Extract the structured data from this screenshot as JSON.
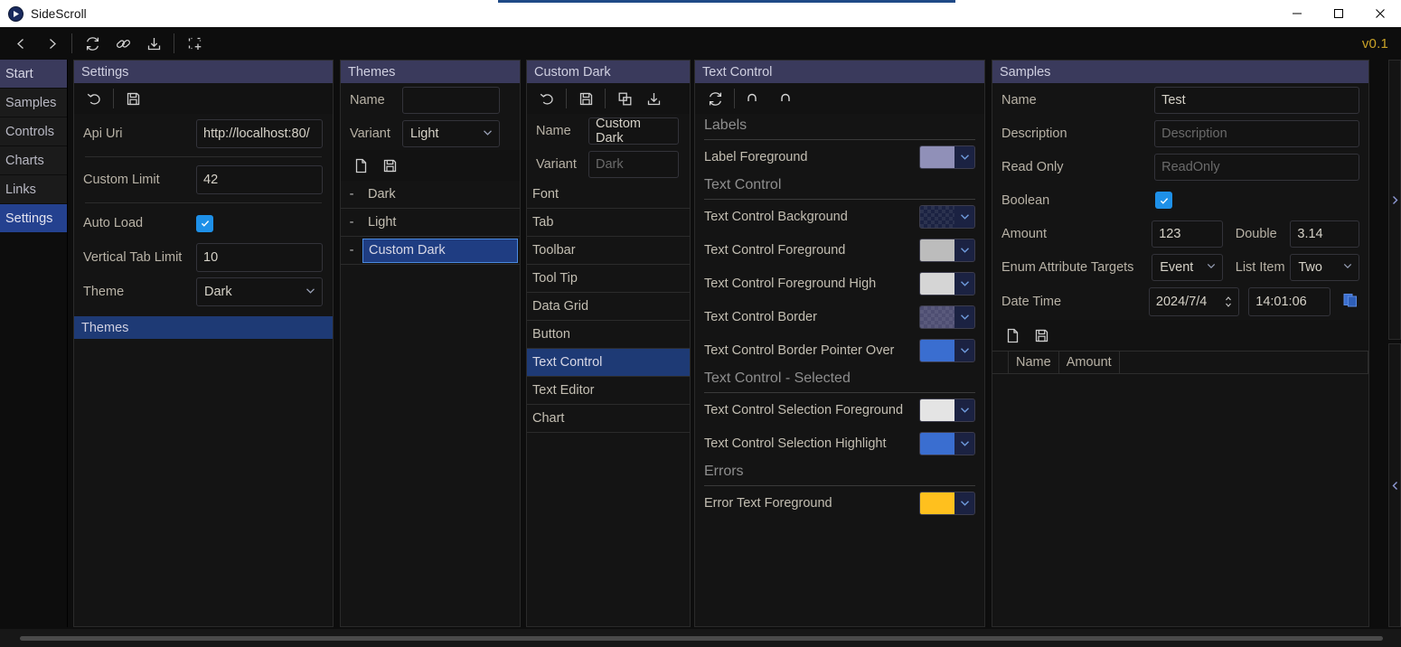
{
  "window": {
    "title": "SideScroll",
    "logo_icon": "play-circle-icon",
    "minimize": "—",
    "maximize": "☐",
    "close": "✕",
    "version": "v0.1"
  },
  "toolbar": {
    "back_icon": "chevron-left-icon",
    "forward_icon": "chevron-right-icon",
    "refresh_icon": "refresh-icon",
    "link_icon": "link-icon",
    "import_icon": "import-icon",
    "snapshot_icon": "snapshot-icon"
  },
  "sidebar": {
    "items": [
      {
        "label": "Start",
        "state": "header"
      },
      {
        "label": "Samples",
        "state": "normal"
      },
      {
        "label": "Controls",
        "state": "normal"
      },
      {
        "label": "Charts",
        "state": "normal"
      },
      {
        "label": "Links",
        "state": "normal"
      },
      {
        "label": "Settings",
        "state": "selected"
      }
    ]
  },
  "settings_panel": {
    "title": "Settings",
    "undo_icon": "undo-icon",
    "save_icon": "save-icon",
    "fields": [
      {
        "label": "Api Uri",
        "value": "http://localhost:80/"
      },
      {
        "label": "Custom Limit",
        "value": "42"
      },
      {
        "label": "Auto Load",
        "value": "checked"
      },
      {
        "label": "Vertical Tab Limit",
        "value": "10"
      },
      {
        "label": "Theme",
        "value": "Dark"
      }
    ],
    "api_uri_label": "Api Uri",
    "api_uri_value": "http://localhost:80/",
    "custom_limit_label": "Custom Limit",
    "custom_limit_value": "42",
    "auto_load_label": "Auto Load",
    "vertical_tab_limit_label": "Vertical Tab Limit",
    "vertical_tab_limit_value": "10",
    "theme_label": "Theme",
    "theme_value": "Dark",
    "themes_section_title": "Themes"
  },
  "themes_panel": {
    "title": "Themes",
    "name_label": "Name",
    "name_value": "",
    "variant_label": "Variant",
    "variant_value": "Light",
    "new_icon": "new-file-icon",
    "save_icon": "save-icon",
    "rows": [
      {
        "expander": "-",
        "name": "Dark",
        "selected": false
      },
      {
        "expander": "-",
        "name": "Light",
        "selected": false
      },
      {
        "expander": "-",
        "name": "Custom Dark",
        "selected": true
      }
    ]
  },
  "custom_dark_panel": {
    "title": "Custom Dark",
    "undo_icon": "undo-icon",
    "save_icon": "save-icon",
    "copy_icon": "copy-icon",
    "import_icon": "import-icon",
    "name_label": "Name",
    "name_value": "Custom Dark",
    "variant_label": "Variant",
    "variant_value": "Dark",
    "items": [
      {
        "label": "Font",
        "selected": false
      },
      {
        "label": "Tab",
        "selected": false
      },
      {
        "label": "Toolbar",
        "selected": false
      },
      {
        "label": "Tool Tip",
        "selected": false
      },
      {
        "label": "Data Grid",
        "selected": false
      },
      {
        "label": "Button",
        "selected": false
      },
      {
        "label": "Text Control",
        "selected": true
      },
      {
        "label": "Text Editor",
        "selected": false
      },
      {
        "label": "Chart",
        "selected": false
      }
    ]
  },
  "text_control_panel": {
    "title": "Text Control",
    "refresh_icon": "refresh-icon",
    "undo_icon": "undo-icon",
    "redo_icon": "redo-icon",
    "sections": [
      {
        "title": "Labels",
        "colors": [
          {
            "label": "Label Foreground",
            "hex": "#9090b8",
            "transparent": false
          }
        ]
      },
      {
        "title": "Text Control",
        "colors": [
          {
            "label": "Text Control Background",
            "hex": "#1b2242",
            "transparent": true
          },
          {
            "label": "Text Control Foreground",
            "hex": "#bcbcbc",
            "transparent": false
          },
          {
            "label": "Text Control Foreground High",
            "hex": "#d5d5d5",
            "transparent": false
          },
          {
            "label": "Text Control Border",
            "hex": "#4e4e72",
            "transparent": true
          },
          {
            "label": "Text Control Border Pointer Over",
            "hex": "#3a6ed0",
            "transparent": false
          }
        ]
      },
      {
        "title": "Text Control - Selected",
        "colors": [
          {
            "label": "Text Control Selection Foreground",
            "hex": "#e4e4e4",
            "transparent": false
          },
          {
            "label": "Text Control Selection Highlight",
            "hex": "#3a6ed0",
            "transparent": false
          }
        ]
      },
      {
        "title": "Errors",
        "colors": [
          {
            "label": "Error Text Foreground",
            "hex": "#ffc01e",
            "transparent": false
          }
        ]
      }
    ]
  },
  "samples_panel": {
    "title": "Samples",
    "name_label": "Name",
    "name_value": "Test",
    "description_label": "Description",
    "description_placeholder": "Description",
    "read_only_label": "Read Only",
    "read_only_placeholder": "ReadOnly",
    "boolean_label": "Boolean",
    "boolean_checked": true,
    "amount_label": "Amount",
    "amount_value": "123",
    "double_label": "Double",
    "double_value": "3.14",
    "enum_label": "Enum Attribute Targets",
    "enum_value": "Event",
    "list_item_label": "List Item",
    "list_item_value": "Two",
    "date_time_label": "Date Time",
    "date_value": "2024/7/4",
    "time_value": "14:01:06",
    "new_icon": "new-file-icon",
    "save_icon": "save-icon",
    "paste_icon": "paste-icon",
    "grid_columns": [
      "Name",
      "Amount"
    ],
    "grid_rows": []
  },
  "edge": {
    "expand_right_icon": "chevron-right-icon",
    "collapse_left_icon": "chevron-left-icon"
  },
  "colors": {
    "panel_header": "#3a3a5c",
    "panel_header_active": "#1e3a75",
    "selection": "#24418f",
    "accent_blue": "#1e90e8",
    "version_gold": "#c9a227"
  }
}
